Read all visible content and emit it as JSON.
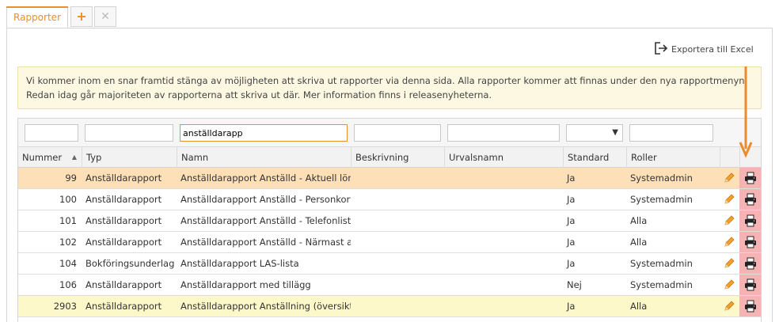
{
  "tabs": {
    "active_label": "Rapporter",
    "add_glyph": "+",
    "close_glyph": "✕"
  },
  "toolbar": {
    "export_label": "Exportera till Excel",
    "export_icon": "export-icon"
  },
  "notice": {
    "text": "Vi kommer inom en snar framtid stänga av möjligheten att skriva ut rapporter via denna sida. Alla rapporter kommer att finnas under den nya rapportmenyn. Redan idag går majoriteten av rapporterna att skriva ut där. Mer information finns i releasenyheterna."
  },
  "filters": {
    "nummer": "",
    "typ": "",
    "namn": "anställdarapp",
    "beskrivning": "",
    "urvalsnamn": "",
    "standard": "",
    "roller": ""
  },
  "columns": [
    "Nummer",
    "Typ",
    "Namn",
    "Beskrivning",
    "Urvalsnamn",
    "Standard",
    "Roller"
  ],
  "rows": [
    {
      "nummer": "99",
      "typ": "Anställdarapport",
      "namn": "Anställdarapport Anställd - Aktuell lön",
      "beskrivning": "",
      "urvalsnamn": "",
      "standard": "Ja",
      "roller": "Systemadmin"
    },
    {
      "nummer": "100",
      "typ": "Anställdarapport",
      "namn": "Anställdarapport Anställd - Personkort",
      "beskrivning": "",
      "urvalsnamn": "",
      "standard": "Ja",
      "roller": "Systemadmin"
    },
    {
      "nummer": "101",
      "typ": "Anställdarapport",
      "namn": "Anställdarapport Anställd - Telefonlista",
      "beskrivning": "",
      "urvalsnamn": "",
      "standard": "Ja",
      "roller": "Alla"
    },
    {
      "nummer": "102",
      "typ": "Anställdarapport",
      "namn": "Anställdarapport Anställd - Närmast anhörig",
      "beskrivning": "",
      "urvalsnamn": "",
      "standard": "Ja",
      "roller": "Alla"
    },
    {
      "nummer": "104",
      "typ": "Bokföringsunderlag",
      "namn": "Anställdarapport LAS-lista",
      "beskrivning": "",
      "urvalsnamn": "",
      "standard": "Ja",
      "roller": "Systemadmin"
    },
    {
      "nummer": "106",
      "typ": "Anställdarapport",
      "namn": "Anställdarapport med tillägg",
      "beskrivning": "",
      "urvalsnamn": "",
      "standard": "Nej",
      "roller": "Systemadmin"
    },
    {
      "nummer": "2903",
      "typ": "Anställdarapport",
      "namn": "Anställdarapport Anställning (översikt)",
      "beskrivning": "",
      "urvalsnamn": "",
      "standard": "Ja",
      "roller": "Alla"
    }
  ],
  "colors": {
    "accent": "#e8902a",
    "selected_row": "#fde0b8",
    "highlight_row": "#fdf8c9",
    "print_cell": "#f6b3b3"
  }
}
